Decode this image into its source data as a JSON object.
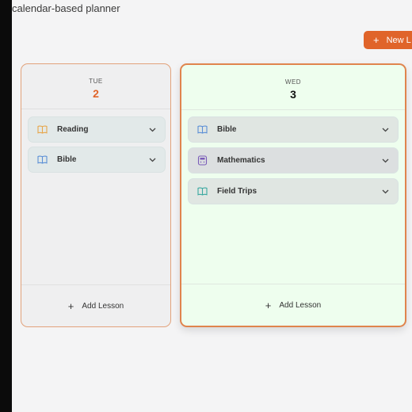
{
  "header": {
    "subtitle": "calendar-based planner",
    "new_button_label": "New L"
  },
  "columns": [
    {
      "dow": "TUE",
      "day": "2",
      "lessons": [
        {
          "label": "Reading",
          "icon": "book-icon",
          "icon_color": "#e7a64a"
        },
        {
          "label": "Bible",
          "icon": "book-icon",
          "icon_color": "#5b8fd6"
        }
      ],
      "add_label": "Add Lesson"
    },
    {
      "dow": "WED",
      "day": "3",
      "lessons": [
        {
          "label": "Bible",
          "icon": "book-icon",
          "icon_color": "#5b8fd6"
        },
        {
          "label": "Mathematics",
          "icon": "calculator-icon",
          "icon_color": "#7a5bb8"
        },
        {
          "label": "Field Trips",
          "icon": "book-icon",
          "icon_color": "#3aa8a0"
        }
      ],
      "add_label": "Add Lesson"
    }
  ],
  "colors": {
    "accent": "#e0642a",
    "today_bg": "#eefeee",
    "today_border": "#e0844d"
  }
}
